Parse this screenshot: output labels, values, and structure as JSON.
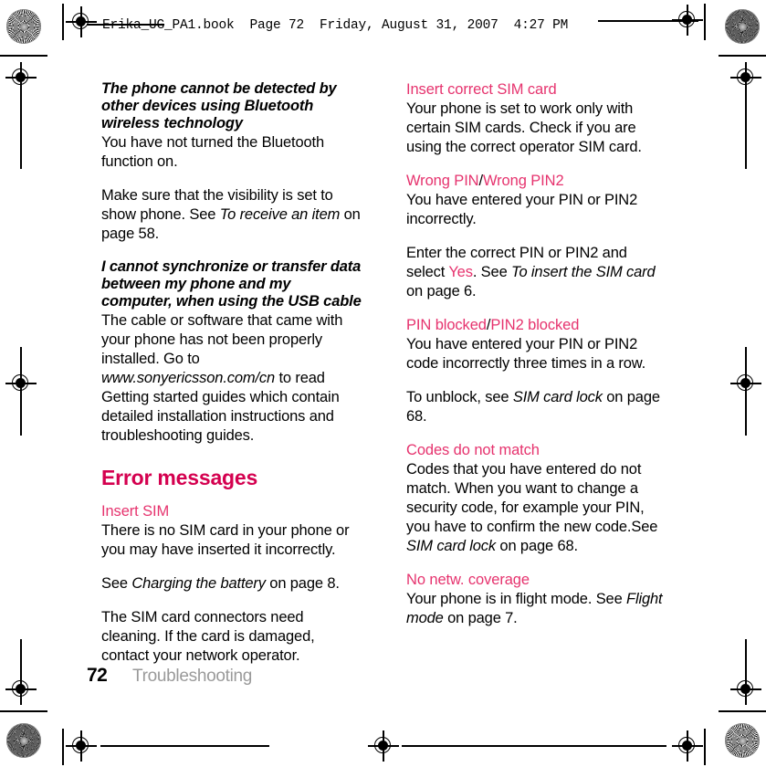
{
  "header": {
    "slug": "Erika_UG_PA1.book  Page 72  Friday, August 31, 2007  4:27 PM"
  },
  "footer": {
    "page_number": "72",
    "chapter": "Troubleshooting"
  },
  "colors": {
    "heading_pink": "#d4004f",
    "term_pink": "#e6336e",
    "body_black": "#000000",
    "footer_grey": "#9a9a9a"
  },
  "left_column": {
    "blocks": [
      {
        "subheading": "The phone cannot be detected by other devices using Bluetooth wireless technology",
        "paragraph": "You have not turned the Bluetooth function on."
      },
      {
        "paragraph_lead": "Make sure that the visibility is set to show phone. See ",
        "paragraph_italic": "To receive an item",
        "paragraph_tail": " on page 58."
      },
      {
        "subheading": "I cannot synchronize or transfer data between my phone and my computer, when using the USB cable",
        "paragraph_lead": "The cable or software that came with your phone has not been properly installed. Go to ",
        "paragraph_italic": "www.sonyericsson.com/cn",
        "paragraph_tail": " to read Getting started guides which contain detailed installation instructions and troubleshooting guides."
      }
    ],
    "section_heading": "Error messages",
    "error_items": [
      {
        "term": "Insert SIM",
        "paragraph": "There is no SIM card in your phone or you may have inserted it incorrectly."
      }
    ],
    "extra_paragraphs": [
      {
        "lead": "See ",
        "italic": "Charging the battery",
        "tail": " on page 8."
      },
      {
        "lead": "The SIM card connectors need cleaning. If the card is damaged, contact your network operator.",
        "italic": "",
        "tail": ""
      }
    ]
  },
  "right_column": {
    "error_items": [
      {
        "term": "Insert correct SIM card",
        "term_separator": "",
        "term2": "",
        "paragraph": "Your phone is set to work only with certain SIM cards. Check if you are using the correct operator SIM card."
      },
      {
        "term": "Wrong PIN",
        "term_separator": "/",
        "term2": "Wrong PIN2",
        "paragraph": "You have entered your PIN or PIN2 incorrectly."
      },
      {
        "term": "PIN blocked",
        "term_separator": "/",
        "term2": "PIN2 blocked",
        "paragraph": "You have entered your PIN or PIN2 code incorrectly three times in a row."
      },
      {
        "term": "Codes do not match",
        "term_separator": "",
        "term2": "",
        "paragraph": "Codes that you have entered do not match. When you want to change a security code, for example your PIN, you have to confirm the new code."
      },
      {
        "term": "No netw. coverage",
        "term_separator": "",
        "term2": "",
        "paragraph": "Your phone is in flight mode. See "
      }
    ],
    "pin_followup": {
      "lead": "Enter the correct PIN or PIN2 and select ",
      "pink": "Yes",
      "mid": ". See ",
      "italic": "To insert the SIM card",
      "tail": " on page 6."
    },
    "unblock_followup": {
      "lead": "To unblock, see ",
      "italic": "SIM card lock",
      "tail": " on page 68."
    },
    "codes_followup": {
      "lead": "See ",
      "italic": "SIM card lock",
      "tail": " on page 68."
    },
    "flight_followup": {
      "italic": "Flight mode",
      "tail": " on page 7."
    }
  }
}
